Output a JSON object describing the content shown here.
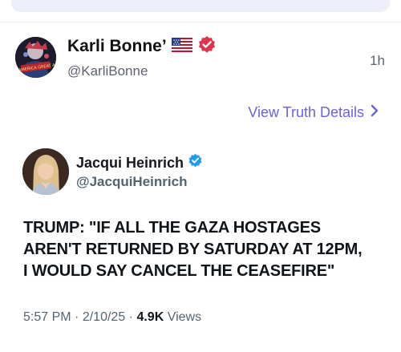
{
  "post": {
    "author_name": "Karli Bonne’",
    "author_flag": "🇺🇸",
    "author_handle": "@KarliBonne",
    "timestamp": "1h",
    "view_details_label": "View Truth Details",
    "avatar_text": "MAKE AMERICA GREAT AGAIN"
  },
  "quoted_tweet": {
    "author_name": "Jacqui Heinrich",
    "author_handle": "@JacquiHeinrich",
    "text": "TRUMP: \"IF ALL THE GAZA HOSTAGES\nAREN'T RETURNED BY SATURDAY AT 12PM,\nI WOULD SAY CANCEL THE CEASEFIRE\"",
    "time": "5:57 PM",
    "date": "2/10/25",
    "views_count": "4.9K",
    "views_label": "Views"
  },
  "colors": {
    "truth_verified": "#e0334c",
    "x_verified": "#1d9bf0",
    "link_purple": "#6b62d9"
  },
  "icons": {
    "truth_badge": "verified-badge-icon",
    "x_badge": "verified-badge-icon",
    "chevron": "chevron-right-icon"
  }
}
